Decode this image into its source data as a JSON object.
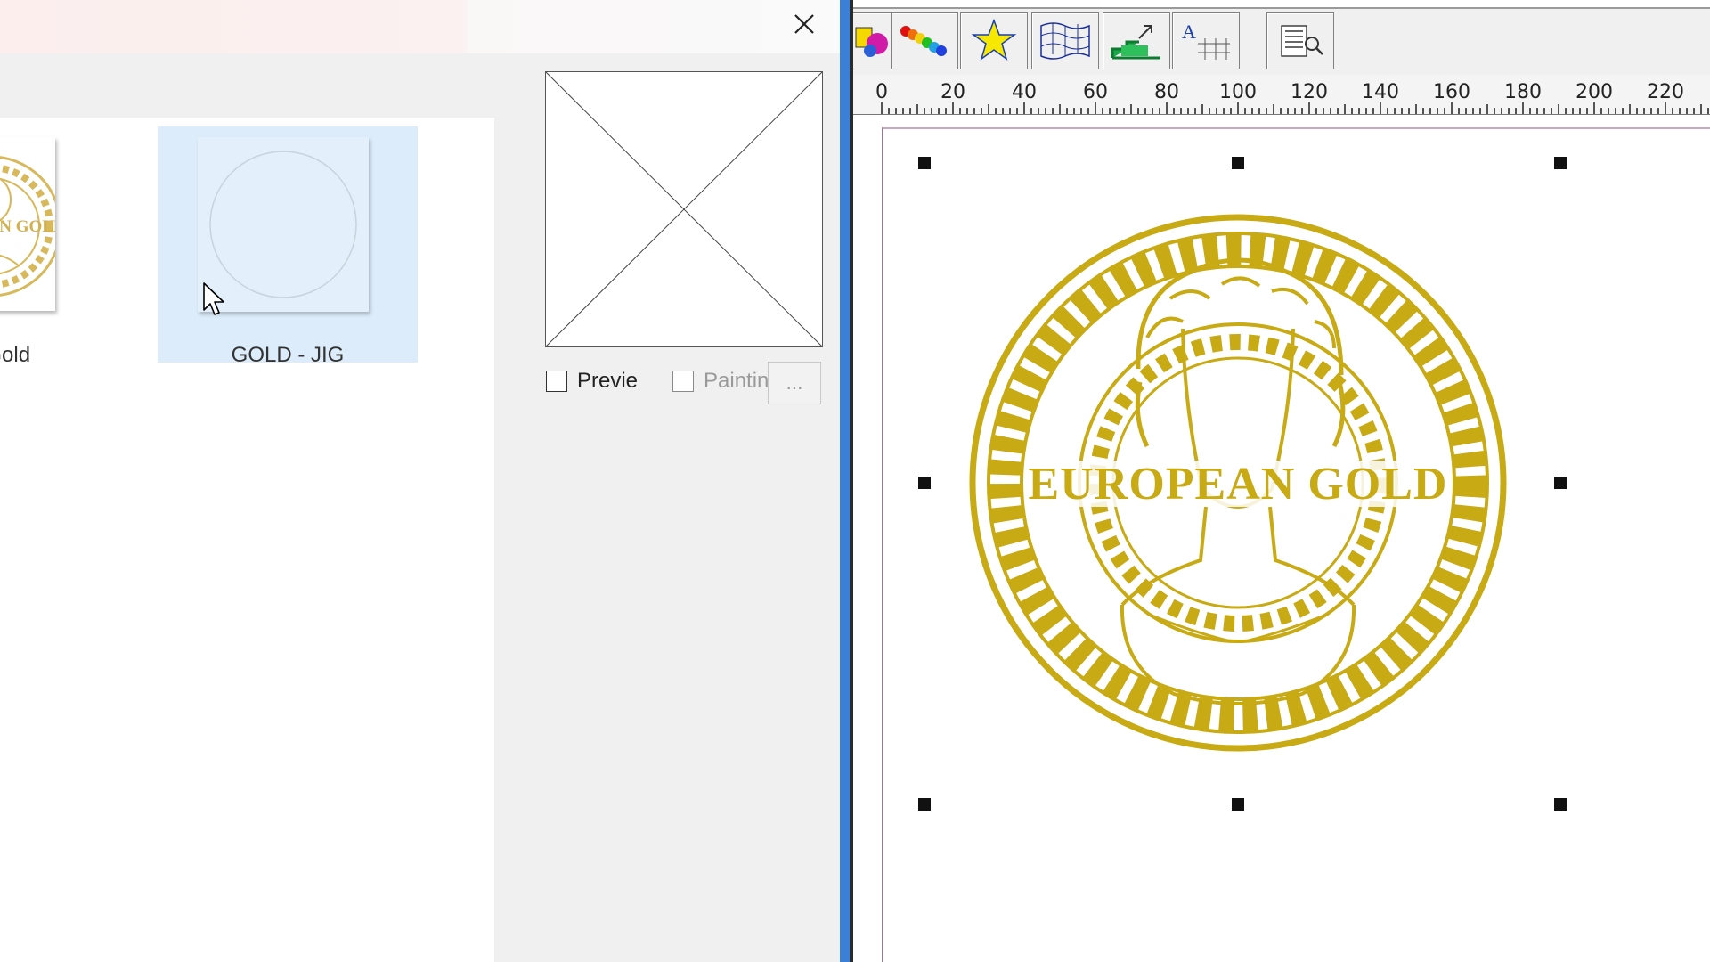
{
  "dialog": {
    "files": [
      {
        "label": "peanGold",
        "thumbnail_text": "EUROPEAN GOLD"
      },
      {
        "label": "GOLD - JIG"
      }
    ],
    "preview_checkbox_label": "Previe",
    "painting_checkbox_label": "Paintin",
    "more_button_label": "..."
  },
  "ruler": {
    "ticks": [
      "0",
      "20",
      "40",
      "60",
      "80",
      "100",
      "120",
      "140",
      "160",
      "180",
      "200",
      "220"
    ]
  },
  "design": {
    "logo_text": "EUROPEAN GOLD",
    "logo_color": "#c8aa14"
  },
  "colors": {
    "accent_divider": "#3a7fd8",
    "selection": "#dcecfa"
  },
  "icons": [
    "close-icon",
    "mouse-cursor-icon",
    "fill-color-icon",
    "rainbow-gradient-icon",
    "star-icon",
    "mesh-warp-icon",
    "import-icon",
    "text-fit-icon",
    "find-view-icon"
  ]
}
